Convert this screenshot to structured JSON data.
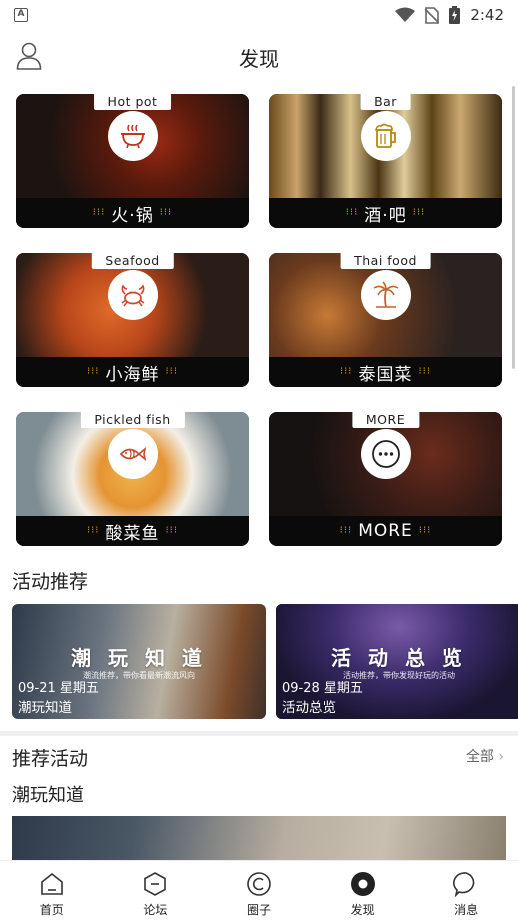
{
  "status": {
    "time": "2:42"
  },
  "header": {
    "title": "发现"
  },
  "categories": [
    {
      "tag": "Hot pot",
      "label": "火·锅",
      "icon": "hotpot-icon"
    },
    {
      "tag": "Bar",
      "label": "酒·吧",
      "icon": "beer-mug-icon"
    },
    {
      "tag": "Seafood",
      "label": "小海鲜",
      "icon": "crab-icon"
    },
    {
      "tag": "Thai food",
      "label": "泰国菜",
      "icon": "palm-tree-icon"
    },
    {
      "tag": "Pickled fish",
      "label": "酸菜鱼",
      "icon": "fish-icon"
    },
    {
      "tag": "MORE",
      "label": "MORE",
      "icon": "more-icon"
    }
  ],
  "activities": {
    "title": "活动推荐",
    "items": [
      {
        "big": "潮 玩 知 道",
        "small": "潮流推荐，带你看最新潮流风向",
        "date": "09-21 星期五",
        "name": "潮玩知道"
      },
      {
        "big": "活 动 总 览",
        "small": "活动推荐，带你发现好玩的活动",
        "date": "09-28 星期五",
        "name": "活动总览"
      }
    ]
  },
  "recommended": {
    "title": "推荐活动",
    "see_all": "全部",
    "subtitle": "潮玩知道"
  },
  "tabs": [
    {
      "label": "首页",
      "icon": "home-icon"
    },
    {
      "label": "论坛",
      "icon": "forum-icon"
    },
    {
      "label": "圈子",
      "icon": "circle-icon"
    },
    {
      "label": "发现",
      "icon": "discover-icon",
      "active": true
    },
    {
      "label": "消息",
      "icon": "message-icon"
    }
  ],
  "colors": {
    "accent_dots": "#d6a21d",
    "band": "#0a0a0a",
    "text": "#222222"
  }
}
